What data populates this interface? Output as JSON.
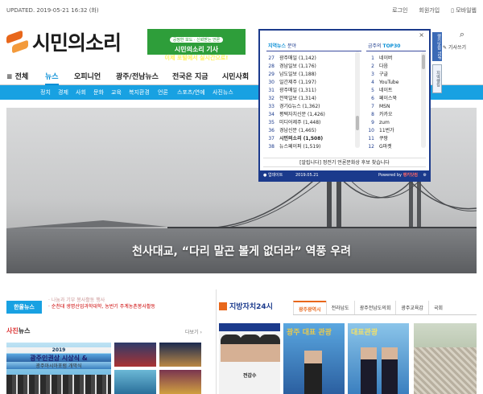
{
  "header": {
    "updated": "UPDATED. 2019-05-21 16:32 (화)",
    "links": [
      "로그인",
      "회원가입",
      "모바일웹"
    ],
    "logo_text": "시민의",
    "logo_text2": "소리",
    "banner_small": "공정한 보도 · 신뢰받는 언론",
    "banner_line1": "시민의소리 기사",
    "banner_line2": "이제 포털에서 실시간으로!",
    "search_icon": "search-icon",
    "write_label": "기사쓰기"
  },
  "nav": {
    "all_label": "≡ 전체",
    "items": [
      "뉴스",
      "오피니언",
      "광주/전남뉴스",
      "전국은 지금",
      "시민사회"
    ],
    "active": "뉴스"
  },
  "subnav": [
    "정치",
    "경제",
    "사회",
    "문화",
    "교육",
    "복지환경",
    "언론",
    "스포츠/연예",
    "사진뉴스"
  ],
  "hero": {
    "caption": "천사대교, “다리 말곤 볼게 없더라” 역풍 우려"
  },
  "ranking": {
    "tab_left_a": "지역뉴스",
    "tab_left_b": "분야",
    "tab_right_a": "금주의",
    "tab_right_b": "TOP30",
    "left": [
      {
        "n": "27",
        "t": "광주매일 (1,142)"
      },
      {
        "n": "28",
        "t": "경남일보 (1,176)"
      },
      {
        "n": "29",
        "t": "남도일보 (1,188)"
      },
      {
        "n": "30",
        "t": "일간제주 (1,197)"
      },
      {
        "n": "31",
        "t": "광주매일 (1,311)"
      },
      {
        "n": "32",
        "t": "전북일보 (1,314)"
      },
      {
        "n": "33",
        "t": "경기G뉴스 (1,362)"
      },
      {
        "n": "34",
        "t": "평택자치신문 (1,426)"
      },
      {
        "n": "35",
        "t": "미디어제주 (1,448)"
      },
      {
        "n": "36",
        "t": "경남신문 (1,465)"
      },
      {
        "n": "37",
        "t": "시민의소리 (1,508)"
      },
      {
        "n": "38",
        "t": "뉴스페이퍼 (1,519)"
      }
    ],
    "right": [
      {
        "n": "1",
        "t": "네이버"
      },
      {
        "n": "2",
        "t": "다음"
      },
      {
        "n": "3",
        "t": "구글"
      },
      {
        "n": "4",
        "t": "YouTube"
      },
      {
        "n": "5",
        "t": "네이트"
      },
      {
        "n": "6",
        "t": "페이스북"
      },
      {
        "n": "7",
        "t": "MSN"
      },
      {
        "n": "8",
        "t": "카카오"
      },
      {
        "n": "9",
        "t": "zum"
      },
      {
        "n": "10",
        "t": "11번가"
      },
      {
        "n": "11",
        "t": "쿠팡"
      },
      {
        "n": "12",
        "t": "G마켓"
      }
    ],
    "notice": "[알립니다] 정전기 언론문화상 후보 찾습니다",
    "footer_update": "업데이트",
    "footer_date": "2019.05.21",
    "footer_powered": "Powered by",
    "footer_brand": "랭키닷컴",
    "side1": "랭키닷컴 TOP",
    "side2": "지역랭킹"
  },
  "left_section": {
    "badge": "한울뉴스",
    "ticker_top": "· 나눔과 기부 봉사활동 행사",
    "ticker": "· 순천대 생명산업과학대학, 농번기 주계농촌봉사활동",
    "photo_title": "사진",
    "photo_title2": "뉴스",
    "more": "다보기 ›",
    "photo_year": "2019",
    "photo_line1": "광주인권상 시상식 &",
    "photo_line2": "광주아시아포럼 개막식"
  },
  "right_section": {
    "title": "지방자치24시",
    "tabs": [
      "광주광역시",
      "전라남도",
      "광주전남도의회",
      "광주교육감",
      "국회"
    ],
    "active_tab": "광주광역시",
    "tile1_name": "전갑수",
    "tile2_text": "광주 대표 관광",
    "tile3_text": "대표관광"
  }
}
